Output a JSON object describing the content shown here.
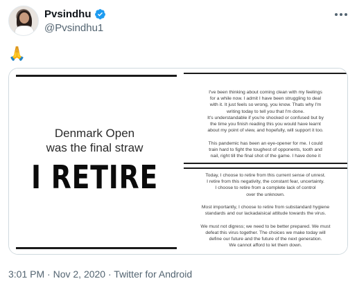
{
  "tweet": {
    "display_name": "Pvsindhu",
    "handle": "@Pvsindhu1",
    "verified_color": "#1d9bf0",
    "text": "🙏",
    "icons": {
      "verified": "verified-badge-icon",
      "more": "more-options-icon"
    }
  },
  "media": {
    "left_image": {
      "headline_line1": "Denmark Open",
      "headline_line2": "was the final straw",
      "big_text": "I RETIRE"
    },
    "right_image": {
      "panel1_lines": [
        "I've been thinking about coming clean with my feelings",
        "for a while now. I admit I have been struggling to deal",
        "with it. It just feels so wrong, you know. Thats why I'm",
        "writing today to tell you that I'm done.",
        "It's understandable if you're shocked or confused but by",
        "the time you finish reading this you would have learnt",
        "about my point of view, and hopefully, will support it too.",
        "",
        "This pandemic has been an eye-opener for me. I could",
        "train hard to fight the toughest of opponents, tooth and",
        "nail, right till the final shot of the game. I have done it"
      ],
      "panel2_lines": [
        "Today, I choose to retire from this current sense of unrest.",
        "I retire from this negativity, the constant fear, uncertainty.",
        "I choose to retire from a complete lack of control",
        "over the unknown.",
        "",
        "Most importantly, I choose to retire from substandard hygiene",
        "standards and our lackadaisical attitude towards the virus.",
        "",
        "We must not digress; we need to be better prepared. We must",
        "defeat this virus together. The choices we make today will",
        "define our future and the future of the next generation.",
        "We cannot afford to let them down."
      ]
    }
  },
  "meta": {
    "time": "3:01 PM",
    "separator": " · ",
    "date": "Nov 2, 2020",
    "source": "Twitter for Android"
  }
}
